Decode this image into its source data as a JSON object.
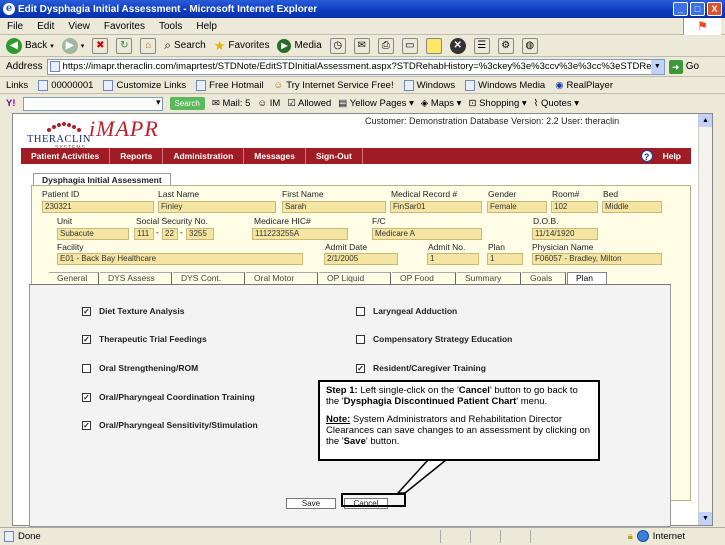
{
  "window": {
    "title": "Edit Dysphagia Initial Assessment - Microsoft Internet Explorer",
    "buttons": [
      "_",
      "□",
      "X"
    ]
  },
  "menubar": [
    "File",
    "Edit",
    "View",
    "Favorites",
    "Tools",
    "Help"
  ],
  "toolbar": {
    "back": "Back",
    "search": "Search",
    "favorites": "Favorites",
    "media": "Media"
  },
  "address": {
    "label": "Address",
    "url": "https://imapr.theraclin.com/imaprtest/STDNote/EditSTDInitialAssessment.aspx?STDRehabHistory=%3ckey%3e%3ccv%3e%3cc%3eSTDReha",
    "go": "Go"
  },
  "links": {
    "label": "Links",
    "items": [
      "00000001",
      "Customize Links",
      "Free Hotmail",
      "Try Internet Service Free!",
      "Windows",
      "Windows Media",
      "RealPlayer"
    ]
  },
  "yahoo": {
    "search": "Search",
    "items": [
      "Mail: 5",
      "IM",
      "Allowed",
      "Yellow Pages",
      "Maps",
      "Shopping",
      "Quotes"
    ]
  },
  "app": {
    "logo_text": "THERACLIN",
    "logo_sub": "SYSTEMS",
    "product": "iMAPR",
    "customer_line": "Customer: Demonstration Database Version: 2.2 User: theraclin",
    "nav": [
      "Patient Activities",
      "Reports",
      "Administration",
      "Messages",
      "Sign-Out"
    ],
    "help": "Help"
  },
  "form": {
    "tab": "Dysphagia Initial Assessment",
    "labels": {
      "patient_id": "Patient ID",
      "last_name": "Last Name",
      "first_name": "First Name",
      "mrn": "Medical Record #",
      "gender": "Gender",
      "room": "Room#",
      "bed": "Bed",
      "unit": "Unit",
      "ssn": "Social Security No.",
      "medicare": "Medicare HIC#",
      "fc": "F/C",
      "dob": "D.O.B.",
      "facility": "Facility",
      "admit_date": "Admit Date",
      "admit_no": "Admit No.",
      "plan": "Plan",
      "physician": "Physician Name"
    },
    "values": {
      "patient_id": "230321",
      "last_name": "Finley",
      "first_name": "Sarah",
      "mrn": "FinSar01",
      "gender": "Female",
      "room": "102",
      "bed": "Middle",
      "unit": "Subacute",
      "ssn1": "111",
      "ssn2": "22",
      "ssn3": "3255",
      "medicare": "111223255A",
      "fc": "Medicare A",
      "dob": "11/14/1920",
      "facility": "E01 - Back Bay Healthcare",
      "admit_date": "2/1/2005",
      "admit_no": "1",
      "plan": "1",
      "physician": "F06057 - Bradley, Milton"
    },
    "subtabs": [
      "General",
      "DYS Assess",
      "DYS Cont.",
      "Oral Motor",
      "OP Liquid",
      "OP Food",
      "Summary",
      "Goals",
      "Plan"
    ],
    "plan_left": [
      {
        "label": "Diet Texture Analysis",
        "checked": true
      },
      {
        "label": "Therapeutic Trial Feedings",
        "checked": true
      },
      {
        "label": "Oral Strengthening/ROM",
        "checked": false
      },
      {
        "label": "Oral/Pharyngeal Coordination Training",
        "checked": true
      },
      {
        "label": "Oral/Pharyngeal Sensitivity/Stimulation",
        "checked": true
      }
    ],
    "plan_right": [
      {
        "label": "Laryngeal Adduction",
        "checked": false
      },
      {
        "label": "Compensatory Strategy Education",
        "checked": false
      },
      {
        "label": "Resident/Caregiver Training",
        "checked": true
      }
    ],
    "save": "Save",
    "cancel": "Cancel"
  },
  "callout": {
    "step": "Step 1:",
    "text1": " Left single-click on the '",
    "cancel_word": "Cancel",
    "text2": "' button to go back to the '",
    "menu_name": "Dysphagia Discontinued Patient Chart",
    "text3": "' menu.",
    "note_label": "Note:",
    "note_text": " System Administrators and Rehabilitation Director Clearances can save changes to an assessment by clicking on the '",
    "save_word": "Save",
    "note_end": "' button."
  },
  "status": {
    "left": "Done",
    "zone": "Internet"
  }
}
